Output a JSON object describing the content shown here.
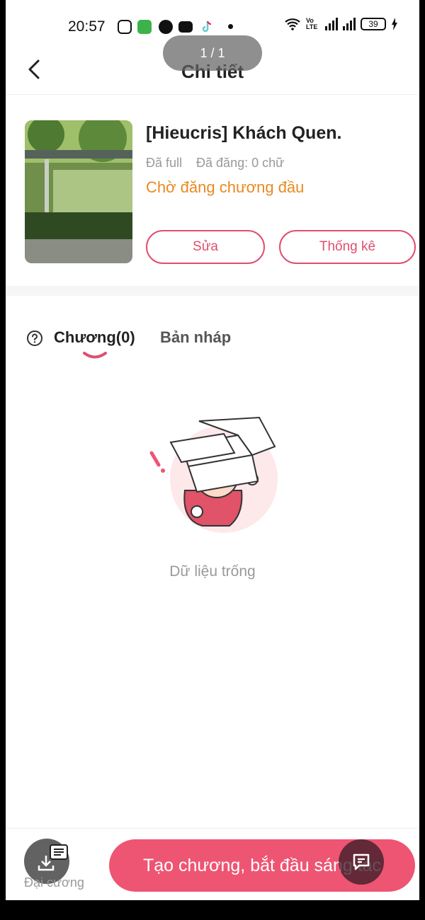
{
  "status_bar": {
    "time": "20:57",
    "volte": "Vo LTE",
    "battery": "39"
  },
  "page_indicator": "1 / 1",
  "header": {
    "title": "Chi tiết"
  },
  "book": {
    "title": "[Hieucris] Khách Quen.",
    "completion": "Đã full",
    "published": "Đã đăng: 0 chữ",
    "status": "Chờ đăng chương đầu",
    "edit_label": "Sửa",
    "stats_label": "Thống kê"
  },
  "tabs": [
    {
      "label": "Chương(0)",
      "active": true
    },
    {
      "label": "Bản nháp",
      "active": false
    }
  ],
  "empty": {
    "text": "Dữ liệu trống"
  },
  "bottom": {
    "outline_label": "Đại cương",
    "create_label": "Tạo chương, bắt đầu sáng tác"
  },
  "colors": {
    "accent": "#ee5573",
    "status": "#e8891f",
    "muted": "#999999"
  }
}
